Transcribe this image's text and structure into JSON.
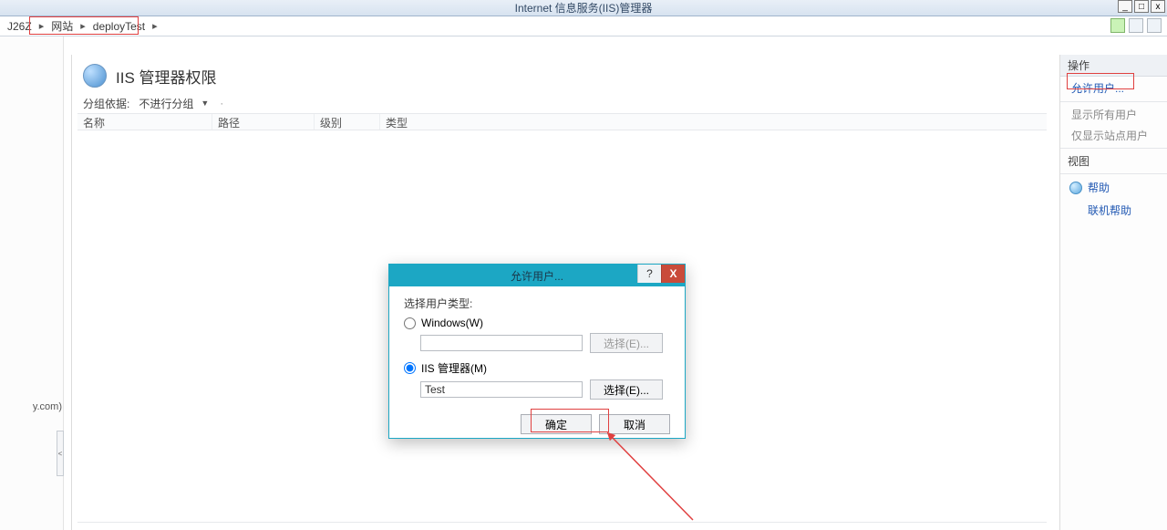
{
  "titlebar": {
    "title": "Internet 信息服务(IIS)管理器",
    "min": "_",
    "max": "□",
    "close": "x"
  },
  "breadcrumb": {
    "root": "J26Z",
    "level1": "网站",
    "level2": "deployTest"
  },
  "left_gutter": {
    "cut_text": "y.com)",
    "toggle": "<"
  },
  "main": {
    "title": "IIS 管理器权限",
    "group_label": "分组依据:",
    "group_value": "不进行分组",
    "columns": {
      "name": "名称",
      "path": "路径",
      "level": "级别",
      "type": "类型"
    }
  },
  "actions": {
    "panel_title": "操作",
    "allow_user": "允许用户...",
    "show_all": "显示所有用户",
    "show_site": "仅显示站点用户",
    "view": "视图",
    "help": "帮助",
    "online_help": "联机帮助"
  },
  "dialog": {
    "title": "允许用户...",
    "help_btn": "?",
    "close_btn": "X",
    "select_type_label": "选择用户类型:",
    "opt_windows": "Windows(W)",
    "opt_iis": "IIS 管理器(M)",
    "select_btn": "选择(E)...",
    "iis_value": "Test",
    "ok": "确定",
    "cancel": "取消"
  }
}
